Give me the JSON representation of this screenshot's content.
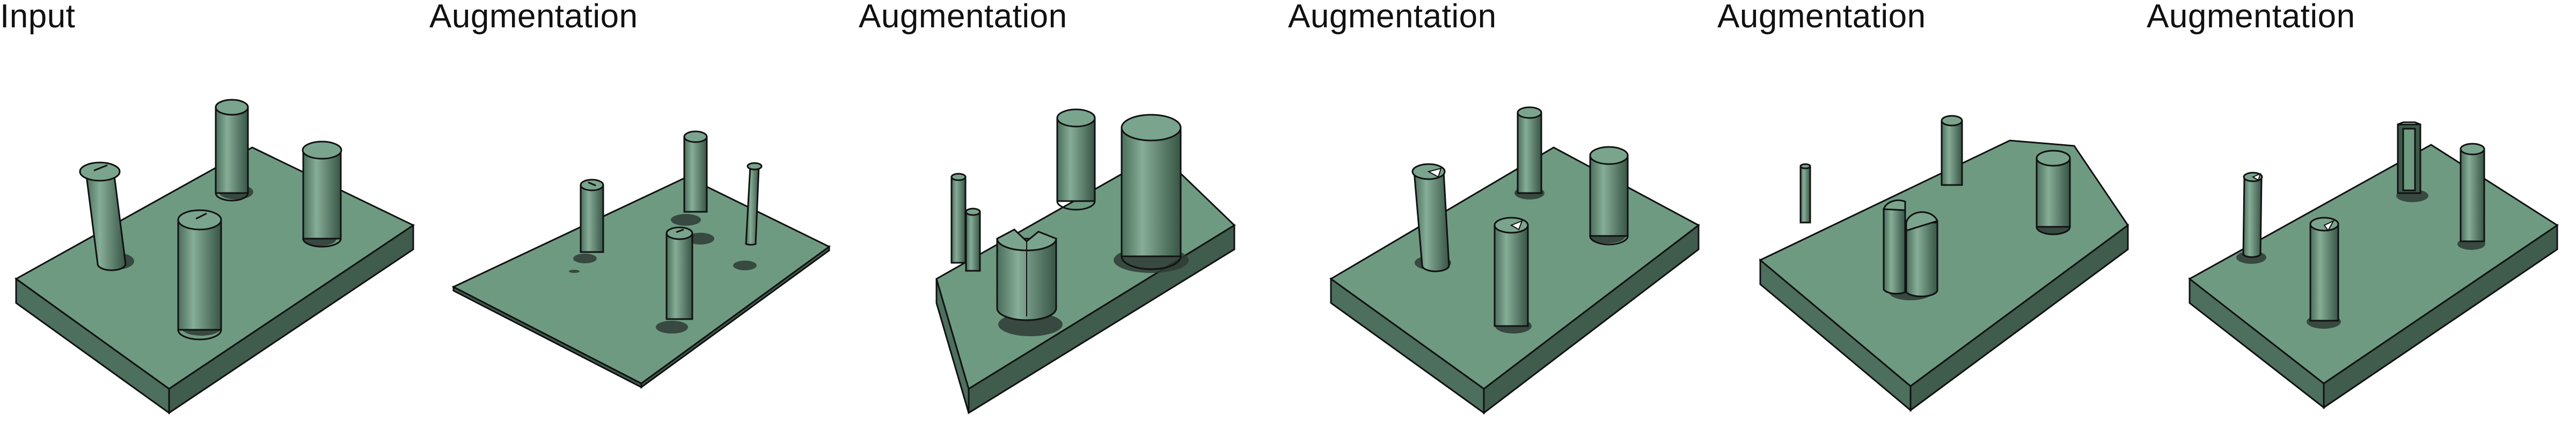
{
  "figure": {
    "panels": [
      {
        "label": "Input"
      },
      {
        "label": "Augmentation"
      },
      {
        "label": "Augmentation"
      },
      {
        "label": "Augmentation"
      },
      {
        "label": "Augmentation"
      },
      {
        "label": "Augmentation"
      }
    ],
    "colors": {
      "board_top": "#6f9a82",
      "board_side": "#4d6f5d",
      "board_side_dark": "#3f5c4d",
      "cylinder_light": "#7fa893",
      "cylinder_dark": "#3c5a4a",
      "cylinder_top": "#7aa48d",
      "outline": "#111111",
      "background": "#ffffff"
    }
  }
}
